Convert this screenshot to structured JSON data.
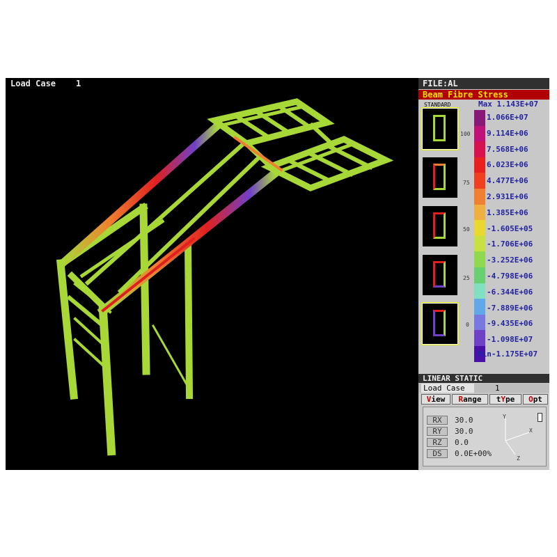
{
  "title_bar": {
    "load_case_label": "Load Case",
    "load_case_number": "1"
  },
  "panel": {
    "file_label": "FILE:AL",
    "result_title": "Beam Fibre Stress",
    "section_mode": "STANDARD",
    "percent_labels": [
      "100",
      "75",
      "50",
      "25",
      "0"
    ],
    "legend": {
      "max_label": "Max",
      "max_value": "1.143E+07",
      "values": [
        "1.066E+07",
        "9.114E+06",
        "7.568E+06",
        "6.023E+06",
        "4.477E+06",
        "2.931E+06",
        "1.385E+06",
        "-1.605E+05",
        "-1.706E+06",
        "-3.252E+06",
        "-4.798E+06",
        "-6.344E+06",
        "-7.889E+06",
        "-9.435E+06",
        "-1.098E+07"
      ],
      "min_label": "Min",
      "min_value": "-1.175E+07",
      "colors": [
        "#8a1878",
        "#c0107a",
        "#d81050",
        "#e82020",
        "#f04020",
        "#f08030",
        "#f0b040",
        "#e8d830",
        "#c8e040",
        "#90d850",
        "#68d070",
        "#80e0c0",
        "#60a8e8",
        "#7878e0",
        "#7040c8",
        "#4810a8"
      ]
    },
    "solution_type": "LINEAR STATIC",
    "load_case_label": "Load Case",
    "load_case_number": "1",
    "menu": [
      {
        "accel": "V",
        "rest": "iew"
      },
      {
        "accel": "R",
        "rest": "ange"
      },
      {
        "pre": "t",
        "accel": "Y",
        "rest": "pe"
      },
      {
        "accel": "O",
        "rest": "pt"
      }
    ],
    "view": {
      "rx_label": "RX",
      "rx_value": "30.0",
      "ry_label": "RY",
      "ry_value": "30.0",
      "rz_label": "RZ",
      "rz_value": "0.0",
      "ds_label": "DS",
      "ds_value": "0.0E+00%",
      "axis_y": "Y",
      "axis_x": "X",
      "axis_z": "Z"
    }
  },
  "colors": {
    "stress_high": "#e02020",
    "stress_mid": "#a8d838",
    "stress_low": "#7040c8"
  }
}
